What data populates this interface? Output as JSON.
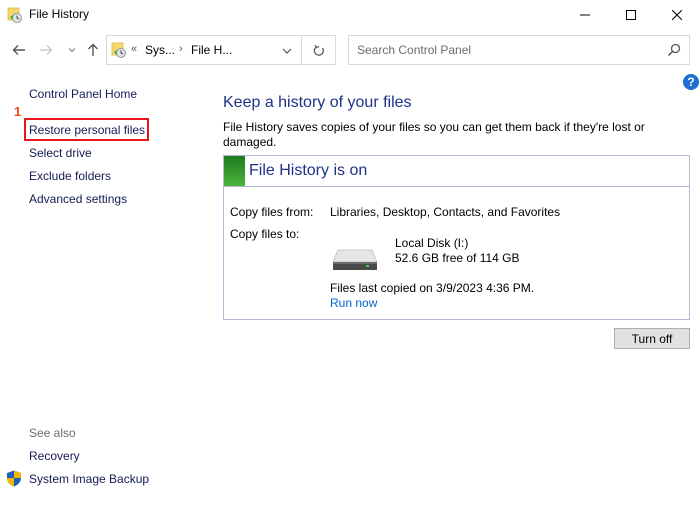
{
  "window": {
    "title": "File History",
    "controls": {
      "minimize": "minimize",
      "maximize": "maximize",
      "close": "close"
    }
  },
  "nav": {
    "back_icon": "arrow-left",
    "forward_icon": "arrow-right",
    "recent_icon": "chevron-down",
    "up_icon": "arrow-up",
    "breadcrumb": {
      "overflow": "«",
      "items": [
        "Sys...",
        "File H..."
      ],
      "separator": "›"
    },
    "refresh_icon": "refresh"
  },
  "search": {
    "placeholder": "Search Control Panel",
    "value": ""
  },
  "help_label": "?",
  "sidebar": {
    "home": "Control Panel Home",
    "items": [
      {
        "label": "Restore personal files",
        "highlighted": true
      },
      {
        "label": "Select drive"
      },
      {
        "label": "Exclude folders"
      },
      {
        "label": "Advanced settings"
      }
    ],
    "annotation_number": "1",
    "see_also_heading": "See also",
    "see_also": [
      {
        "label": "Recovery"
      },
      {
        "label": "System Image Backup",
        "icon": "uac-shield"
      }
    ]
  },
  "main": {
    "title": "Keep a history of your files",
    "description": "File History saves copies of your files so you can get them back if they're lost or damaged.",
    "status": {
      "title": "File History is on",
      "color": "#2e8b2e",
      "copy_from_label": "Copy files from:",
      "copy_from_value": "Libraries, Desktop, Contacts, and Favorites",
      "copy_to_label": "Copy files to:",
      "drive_name": "Local Disk (I:)",
      "drive_space": "52.6 GB free of 114 GB",
      "last_copied": "Files last copied on 3/9/2023 4:36 PM.",
      "run_now": "Run now"
    },
    "turn_off_label": "Turn off"
  }
}
